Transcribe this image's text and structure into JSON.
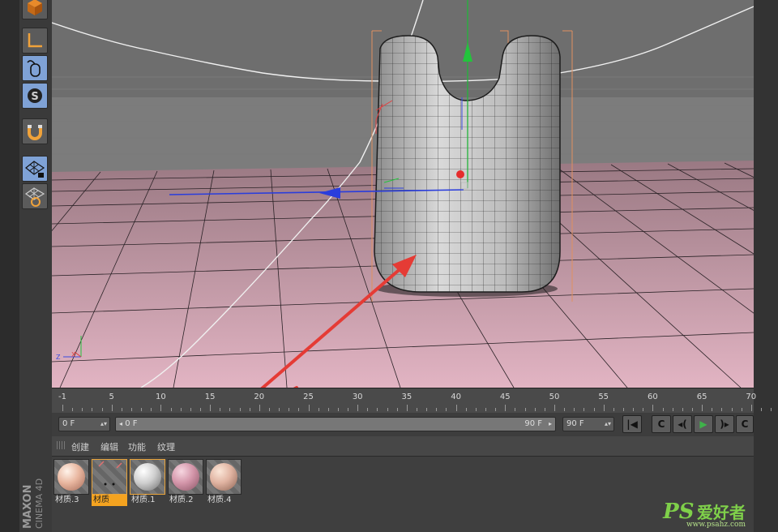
{
  "app": {
    "brand_line1": "MAXON",
    "brand_line2": "CINEMA 4D"
  },
  "toolbar": {
    "tools": [
      {
        "name": "cube-object-icon",
        "color": "#5b5b5b"
      },
      {
        "name": "axis-tool-icon",
        "color": "#5b5b5b"
      },
      {
        "name": "mouse-tool-icon",
        "color": "#7fa2d6"
      },
      {
        "name": "snap-s-icon",
        "color": "#7fa2d6"
      },
      {
        "name": "magnet-icon",
        "color": "#5b5b5b"
      },
      {
        "name": "lock-grid-icon",
        "color": "#7fa2d6"
      },
      {
        "name": "workplane-grid-icon",
        "color": "#5b5b5b"
      }
    ]
  },
  "timeline": {
    "ticks": [
      "-1",
      "5",
      "10",
      "15",
      "20",
      "25",
      "30",
      "35",
      "40",
      "45",
      "50",
      "55",
      "60",
      "65",
      "70"
    ]
  },
  "transport": {
    "current_frame": "0 F",
    "range_start": "0 F",
    "range_end": "90 F",
    "max_frame": "90 F",
    "buttons": [
      "go-to-start-icon",
      "record-icon",
      "previous-key-icon",
      "play-icon",
      "next-key-icon",
      "loop-icon"
    ]
  },
  "materials": {
    "menu": [
      "创建",
      "编辑",
      "功能",
      "纹理"
    ],
    "items": [
      {
        "name": "材质.3",
        "selected": false
      },
      {
        "name": "材质",
        "selected": true
      },
      {
        "name": "材质.1",
        "selected": false
      },
      {
        "name": "材质.2",
        "selected": false
      },
      {
        "name": "材质.4",
        "selected": false
      }
    ]
  },
  "colors": {
    "floor": "#c99aa8",
    "viewport_bg": "#7c7c7c",
    "accent_orange": "#f4a320",
    "arrow_red": "#e53b35"
  },
  "watermark": {
    "logo": "PS",
    "text": "爱好者",
    "url": "www.psahz.com"
  }
}
